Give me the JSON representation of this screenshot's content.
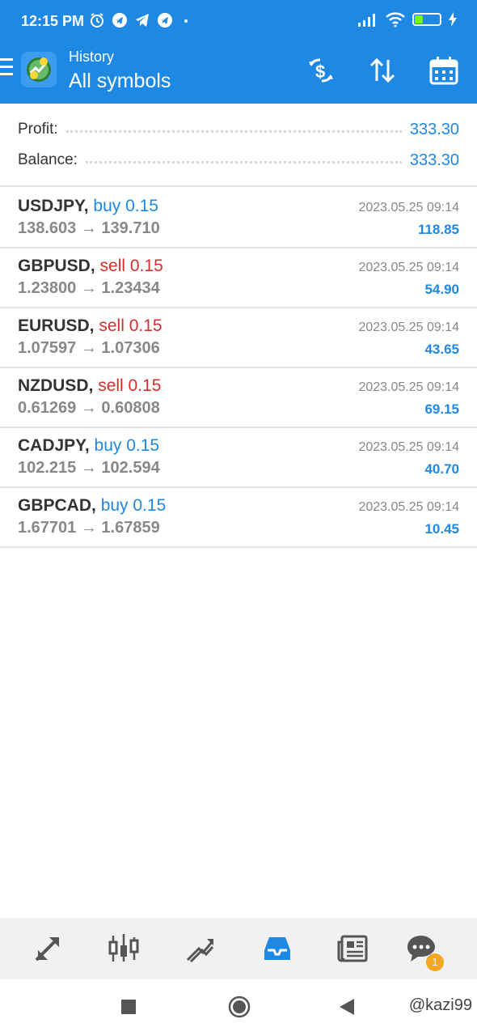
{
  "status_bar": {
    "time": "12:15 PM",
    "battery": "30",
    "icons_left": [
      "alarm-icon",
      "telegram-icon",
      "telegram-icon",
      "telegram-icon",
      "dot-icon"
    ],
    "icons_right": [
      "signal-icon",
      "wifi-icon",
      "battery-icon",
      "charging-icon"
    ]
  },
  "header": {
    "subtitle": "History",
    "title": "All symbols",
    "actions": [
      "deposit-icon",
      "sort-icon",
      "calendar-icon"
    ],
    "accent": "#1e88e5"
  },
  "summary": {
    "profit_label": "Profit:",
    "profit_value": "333.30",
    "balance_label": "Balance:",
    "balance_value": "333.30"
  },
  "trades": [
    {
      "symbol": "USDJPY,",
      "direction": "buy 0.15",
      "type": "buy",
      "prices": "138.603 → 139.710",
      "time": "2023.05.25 09:14",
      "profit": "118.85"
    },
    {
      "symbol": "GBPUSD,",
      "direction": "sell 0.15",
      "type": "sell",
      "prices": "1.23800 → 1.23434",
      "time": "2023.05.25 09:14",
      "profit": "54.90"
    },
    {
      "symbol": "EURUSD,",
      "direction": "sell 0.15",
      "type": "sell",
      "prices": "1.07597 → 1.07306",
      "time": "2023.05.25 09:14",
      "profit": "43.65"
    },
    {
      "symbol": "NZDUSD,",
      "direction": "sell 0.15",
      "type": "sell",
      "prices": "0.61269 → 0.60808",
      "time": "2023.05.25 09:14",
      "profit": "69.15"
    },
    {
      "symbol": "CADJPY,",
      "direction": "buy 0.15",
      "type": "buy",
      "prices": "102.215 → 102.594",
      "time": "2023.05.25 09:14",
      "profit": "40.70"
    },
    {
      "symbol": "GBPCAD,",
      "direction": "buy 0.15",
      "type": "buy",
      "prices": "1.67701 → 1.67859",
      "time": "2023.05.25 09:14",
      "profit": "10.45"
    }
  ],
  "bottom_nav": {
    "items": [
      "quotes-icon",
      "chart-icon",
      "trade-icon",
      "history-icon",
      "news-icon",
      "chat-icon"
    ],
    "active": "history-icon",
    "chat_badge": "1"
  },
  "watermark": "@kazi99"
}
